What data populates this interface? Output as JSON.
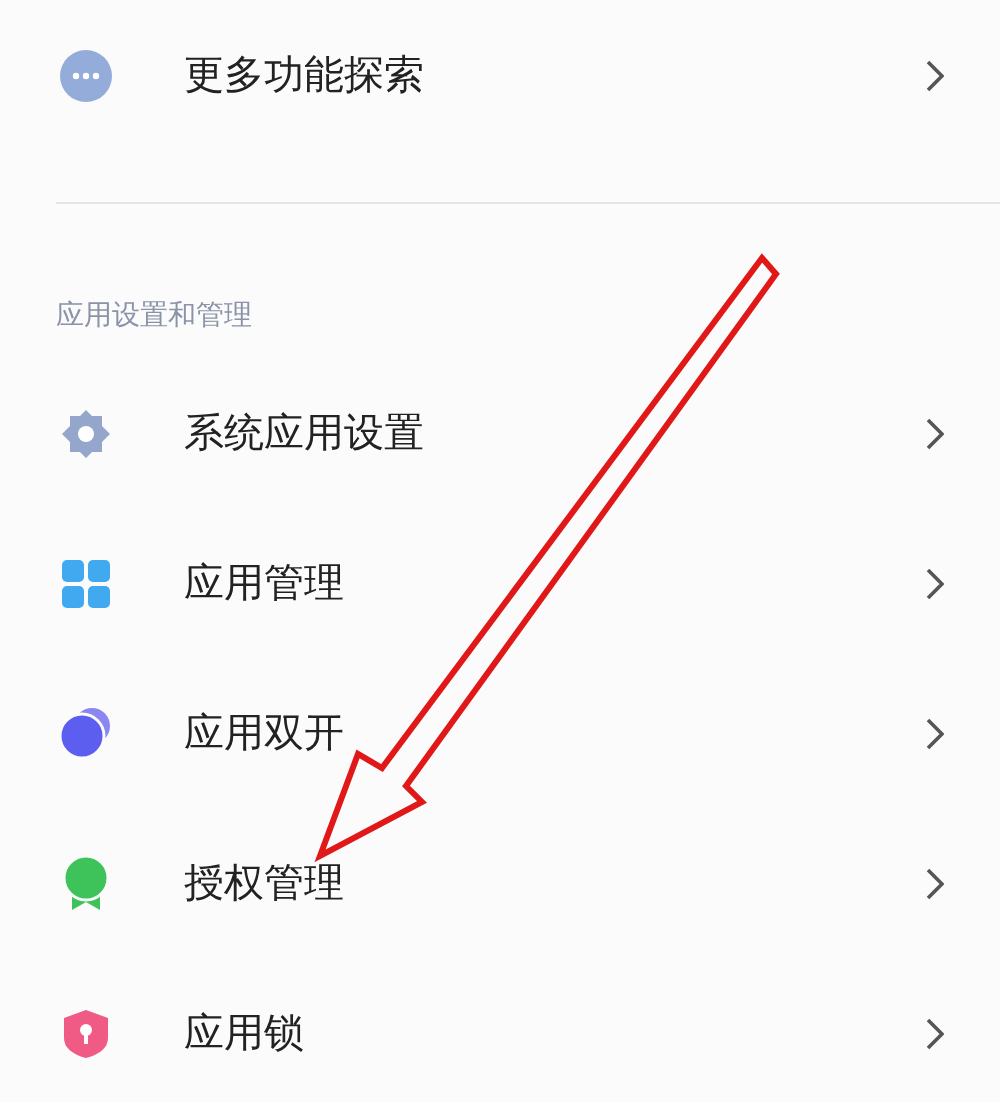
{
  "top_item": {
    "label": "更多功能探索"
  },
  "section": {
    "title": "应用设置和管理",
    "items": [
      {
        "label": "系统应用设置"
      },
      {
        "label": "应用管理"
      },
      {
        "label": "应用双开"
      },
      {
        "label": "授权管理"
      },
      {
        "label": "应用锁"
      }
    ]
  }
}
